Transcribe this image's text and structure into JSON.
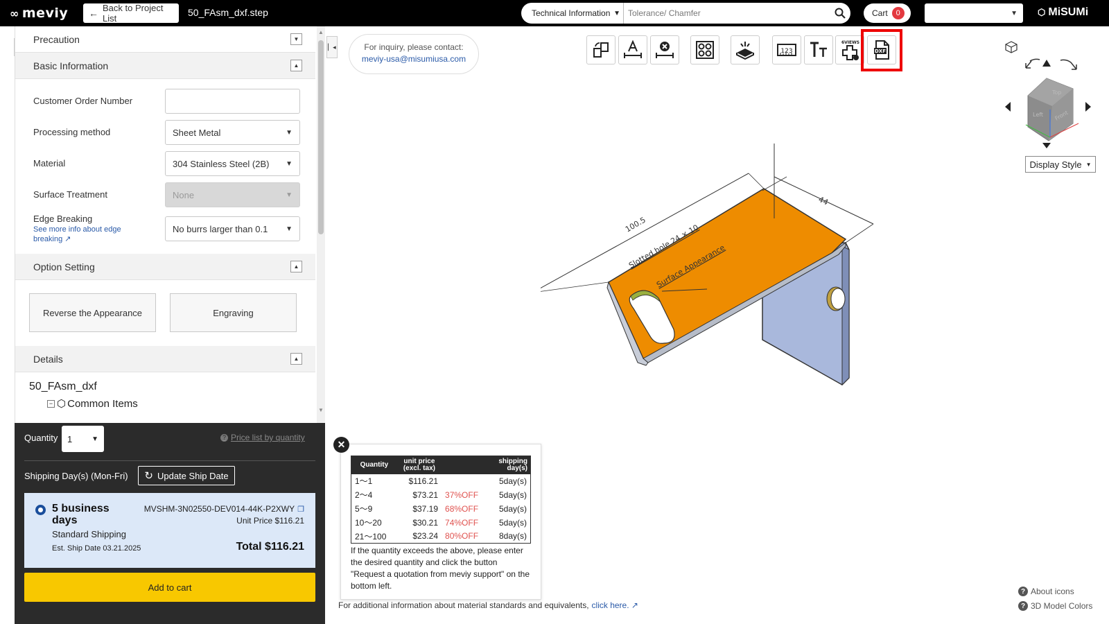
{
  "header": {
    "logo": "meviy",
    "back_label": "Back to Project List",
    "filename": "50_FAsm_dxf.step",
    "search_category": "Technical Information",
    "search_placeholder": "Tolerance/ Chamfer",
    "cart_label": "Cart",
    "cart_count": "0",
    "brand": "MiSUMi"
  },
  "sidebar": {
    "precaution": "Precaution",
    "basic_info": "Basic Information",
    "fields": [
      {
        "label": "Customer Order Number",
        "value": ""
      },
      {
        "label": "Processing method",
        "value": "Sheet Metal"
      },
      {
        "label": "Material",
        "value": "304 Stainless Steel (2B)"
      },
      {
        "label": "Surface Treatment",
        "value": "None"
      },
      {
        "label": "Edge Breaking",
        "value": "No burrs larger than 0.1"
      }
    ],
    "edge_link": "See more info about edge breaking",
    "option_setting": "Option Setting",
    "option_buttons": [
      "Reverse the Appearance",
      "Engraving"
    ],
    "details": "Details",
    "tree_root": "50_FAsm_dxf",
    "tree_item": "Common Items"
  },
  "order": {
    "quantity_label": "Quantity",
    "quantity": "1",
    "price_list_link": "Price list by quantity",
    "shipping_label": "Shipping Day(s) (Mon-Fri)",
    "update_ship": "Update Ship Date",
    "ship_days": "5 business days",
    "ship_type": "Standard Shipping",
    "est_ship": "Est. Ship Date 03.21.2025",
    "part_number": "MVSHM-3N02550-DEV014-44K-P2XWY",
    "unit_price": "Unit Price $116.21",
    "total": "Total $116.21",
    "add_to_cart": "Add to cart"
  },
  "viewer": {
    "contact_line1": "For inquiry, please contact:",
    "contact_email": "meviy-usa@misumiusa.com",
    "display_style": "Display Style",
    "model_labels": {
      "dim1": "100.5",
      "dim2": "44",
      "slot": "Slotted hole 24 × 10",
      "surface": "Surface Appearance"
    },
    "cube_faces": [
      "Top",
      "Left",
      "Front"
    ],
    "accent_color": "#ee8c00",
    "side_color": "#a9b8dc"
  },
  "price_table": {
    "headers": [
      "Quantity",
      "unit price (excl. tax)",
      "",
      "shipping day(s)"
    ],
    "rows": [
      [
        "1～1",
        "$116.21",
        "",
        "5day(s)"
      ],
      [
        "2～4",
        "$73.21",
        "37%OFF",
        "5day(s)"
      ],
      [
        "5～9",
        "$37.19",
        "68%OFF",
        "5day(s)"
      ],
      [
        "10～20",
        "$30.21",
        "74%OFF",
        "5day(s)"
      ],
      [
        "21～100",
        "$23.24",
        "80%OFF",
        "8day(s)"
      ]
    ],
    "note": "If the quantity exceeds the above, please enter the desired quantity and click the button \"Request a quotation from meviy support\" on the bottom left."
  },
  "footer": {
    "material_note": "For additional information about material standards and equivalents,",
    "click_here": "click here.",
    "about_icons": "About icons",
    "model_colors": "3D Model Colors"
  }
}
